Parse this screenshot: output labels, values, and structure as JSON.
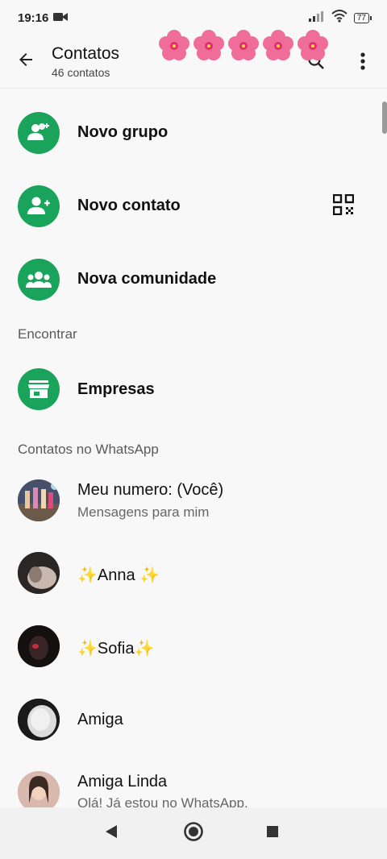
{
  "status_bar": {
    "time": "19:16",
    "battery": "77"
  },
  "header": {
    "title": "Contatos",
    "subtitle": "46 contatos"
  },
  "actions": [
    {
      "label": "Novo grupo",
      "icon": "new-group-icon"
    },
    {
      "label": "Novo contato",
      "icon": "add-contact-icon"
    },
    {
      "label": "Nova comunidade",
      "icon": "community-icon"
    }
  ],
  "sections": {
    "find": "Encontrar",
    "contacts": "Contatos no WhatsApp"
  },
  "businesses": {
    "label": "Empresas",
    "icon": "store-icon"
  },
  "contacts": [
    {
      "name": "Meu numero: (Você)",
      "status": "Mensagens para mim"
    },
    {
      "name": "✨Anna ✨",
      "status": ""
    },
    {
      "name": "✨Sofia✨",
      "status": ""
    },
    {
      "name": "Amiga",
      "status": ""
    },
    {
      "name": "Amiga Linda",
      "status": "Olá! Já estou no WhatsApp."
    }
  ],
  "colors": {
    "accent": "#1aa35b",
    "background": "#f8f8f8",
    "flower": "#f06d9a"
  }
}
